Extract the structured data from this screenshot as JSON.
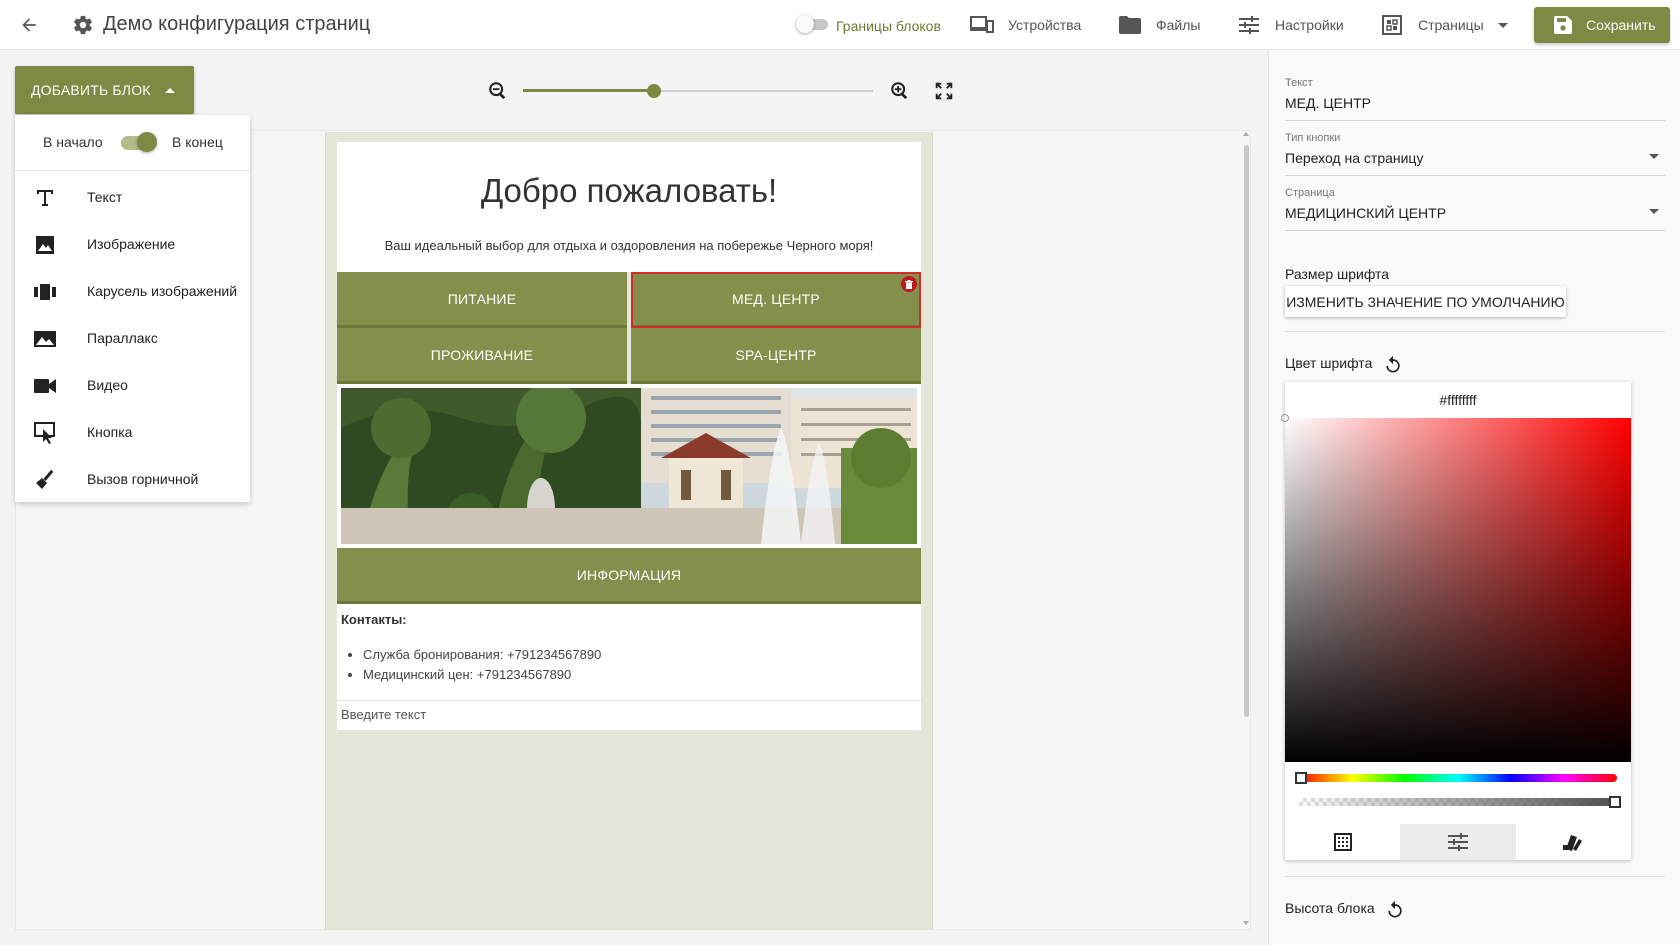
{
  "app": {
    "title": "Демо конфигурация страниц"
  },
  "toolbar": {
    "borders_label": "Границы блоков",
    "devices_label": "Устройства",
    "files_label": "Файлы",
    "settings_label": "Настройки",
    "pages_label": "Страницы",
    "save_label": "Сохранить"
  },
  "add_block": {
    "button_label": "ДОБАВИТЬ БЛОК",
    "position_start": "В начало",
    "position_end": "В конец",
    "items": [
      {
        "label": "Текст",
        "icon": "text-icon"
      },
      {
        "label": "Изображение",
        "icon": "image-icon"
      },
      {
        "label": "Карусель изображений",
        "icon": "carousel-icon"
      },
      {
        "label": "Параллакс",
        "icon": "parallax-icon"
      },
      {
        "label": "Видео",
        "icon": "video-icon"
      },
      {
        "label": "Кнопка",
        "icon": "button-icon"
      },
      {
        "label": "Вызов горничной",
        "icon": "broom-icon"
      }
    ]
  },
  "zoom": {
    "level": 0.375
  },
  "page": {
    "welcome_title": "Добро пожаловать!",
    "welcome_subtitle": "Ваш идеальный выбор для отдыха и оздоровления на побережье Черного моря!",
    "buttons": [
      "ПИТАНИЕ",
      "МЕД. ЦЕНТР",
      "ПРОЖИВАНИЕ",
      "SPA-ЦЕНТР"
    ],
    "info_button": "ИНФОРМАЦИЯ",
    "contacts_title": "Контакты:",
    "contacts": [
      "Служба бронирования: +791234567890",
      "Медицинский цен: +791234567890"
    ],
    "text_placeholder": "Введите текст"
  },
  "properties": {
    "text_label": "Текст",
    "text_value": "МЕД. ЦЕНТР",
    "button_type_label": "Тип кнопки",
    "button_type_value": "Переход на страницу",
    "page_label": "Страница",
    "page_value": "МЕДИЦИНСКИЙ ЦЕНТР",
    "font_size_label": "Размер шрифта",
    "font_size_button": "ИЗМЕНИТЬ ЗНАЧЕНИЕ ПО УМОЛЧАНИЮ",
    "font_color_label": "Цвет шрифта",
    "font_color_hex": "#ffffffff",
    "block_height_label": "Высота блока"
  },
  "colors": {
    "accent": "#7e8a43",
    "button": "#848f4b",
    "selection": "#d42b2b",
    "page_bg": "#e4e6d9"
  }
}
